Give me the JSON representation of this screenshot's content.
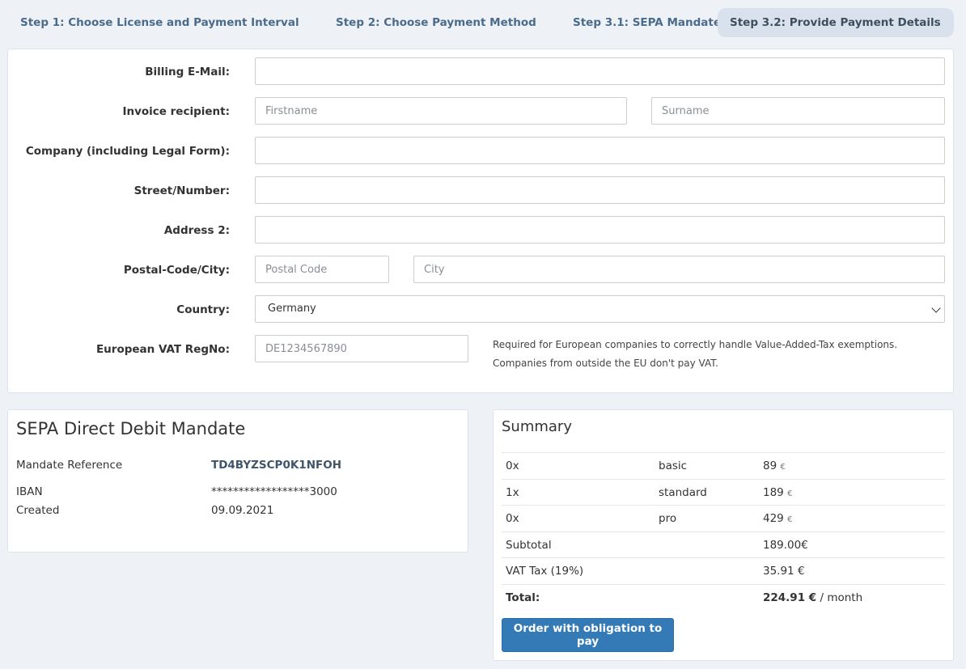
{
  "steps": [
    {
      "label": "Step 1: Choose License and Payment Interval"
    },
    {
      "label": "Step 2: Choose Payment Method"
    },
    {
      "label": "Step 3.1: SEPA Mandate"
    },
    {
      "label": "Step 3.2: Provide Payment Details"
    }
  ],
  "form": {
    "billing_email_label": "Billing E-Mail:",
    "billing_email_value": "",
    "invoice_recipient_label": "Invoice recipient:",
    "firstname_placeholder": "Firstname",
    "surname_placeholder": "Surname",
    "company_label": "Company (including Legal Form):",
    "street_label": "Street/Number:",
    "address2_label": "Address 2:",
    "postal_city_label": "Postal-Code/City:",
    "postal_placeholder": "Postal Code",
    "city_placeholder": "City",
    "country_label": "Country:",
    "country_value": "Germany",
    "vat_label": "European VAT RegNo:",
    "vat_placeholder": "DE1234567890",
    "vat_help": "Required for European companies to correctly handle Value-Added-Tax exemptions. Companies from outside the EU don't pay VAT."
  },
  "sepa": {
    "title": "SEPA Direct Debit Mandate",
    "mandate_reference_label": "Mandate Reference",
    "mandate_reference_value": "TD4BYZSCP0K1NFOH",
    "iban_label": "IBAN",
    "iban_value": "******************3000",
    "created_label": "Created",
    "created_value": "09.09.2021"
  },
  "summary": {
    "title": "Summary",
    "rows": [
      {
        "qty": "0x",
        "plan": "basic",
        "price": "89",
        "currency": "€"
      },
      {
        "qty": "1x",
        "plan": "standard",
        "price": "189",
        "currency": "€"
      },
      {
        "qty": "0x",
        "plan": "pro",
        "price": "429",
        "currency": "€"
      }
    ],
    "subtotal_label": "Subtotal",
    "subtotal_value": "189.00€",
    "vat_label": "VAT Tax (19%)",
    "vat_value": "35.91 €",
    "total_label": "Total:",
    "total_value": "224.91 €",
    "total_period": " / month",
    "order_button": "Order with obligation to pay"
  },
  "colors": {
    "primary_button": "#337ab7",
    "active_step_bg": "#d9e2ec",
    "page_bg": "#eef2f7"
  }
}
